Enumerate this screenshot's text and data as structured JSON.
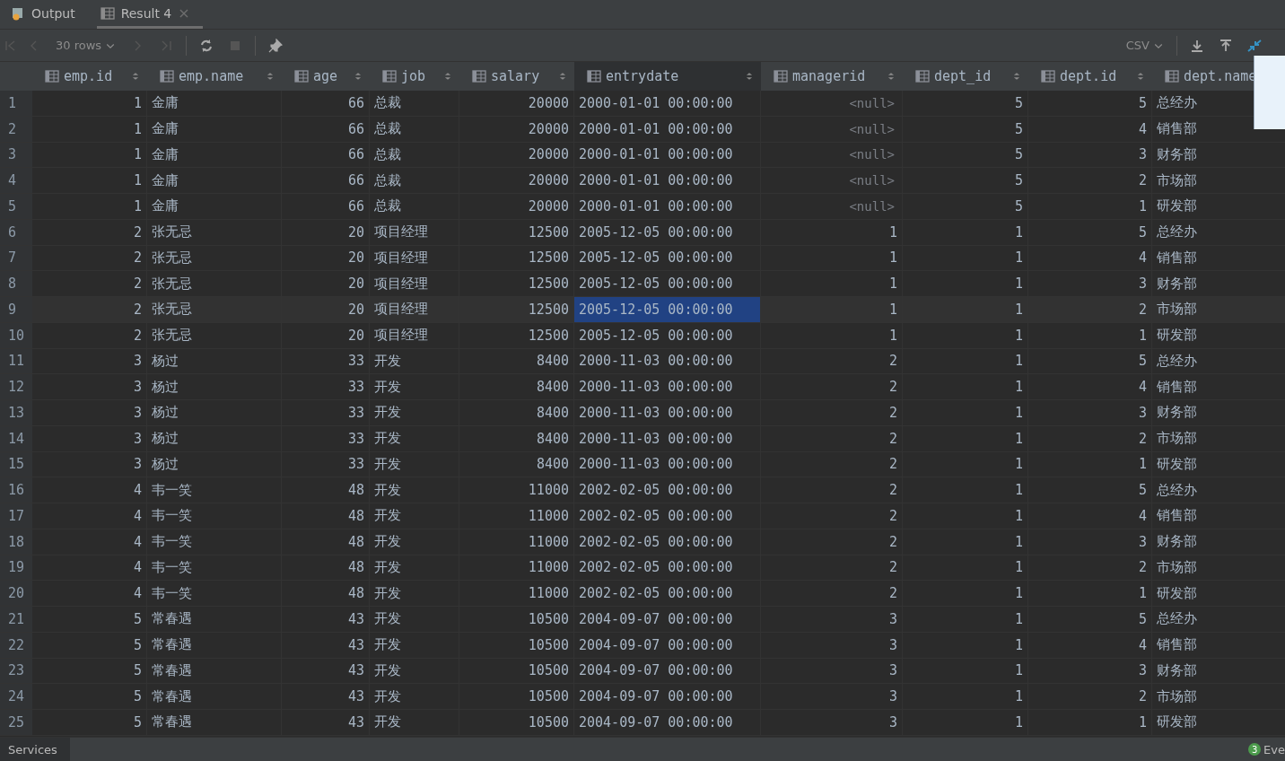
{
  "tabs": [
    {
      "label": "Output",
      "selected": false
    },
    {
      "label": "Result 4",
      "selected": true,
      "close": "×"
    }
  ],
  "toolbar": {
    "page_size": "30 rows",
    "format": "CSV"
  },
  "table": {
    "columns": [
      {
        "label": "emp.id",
        "kind": "number",
        "selected": false
      },
      {
        "label": "emp.name",
        "kind": "text",
        "selected": false
      },
      {
        "label": "age",
        "kind": "number",
        "selected": false
      },
      {
        "label": "job",
        "kind": "text",
        "selected": false
      },
      {
        "label": "salary",
        "kind": "number",
        "selected": false
      },
      {
        "label": "entrydate",
        "kind": "text",
        "selected": true
      },
      {
        "label": "managerid",
        "kind": "number",
        "selected": false
      },
      {
        "label": "dept_id",
        "kind": "number",
        "selected": false
      },
      {
        "label": "dept.id",
        "kind": "number",
        "selected": false
      },
      {
        "label": "dept.name",
        "kind": "text",
        "selected": false
      }
    ],
    "rows": [
      {
        "num": "1",
        "selected": false,
        "manager_null": true,
        "cells": [
          "1",
          "金庸",
          "66",
          "总裁",
          "20000",
          "2000-01-01 00:00:00",
          "<null>",
          "5",
          "5",
          "总经办"
        ]
      },
      {
        "num": "2",
        "selected": false,
        "manager_null": true,
        "cells": [
          "1",
          "金庸",
          "66",
          "总裁",
          "20000",
          "2000-01-01 00:00:00",
          "<null>",
          "5",
          "4",
          "销售部"
        ]
      },
      {
        "num": "3",
        "selected": false,
        "manager_null": true,
        "cells": [
          "1",
          "金庸",
          "66",
          "总裁",
          "20000",
          "2000-01-01 00:00:00",
          "<null>",
          "5",
          "3",
          "财务部"
        ]
      },
      {
        "num": "4",
        "selected": false,
        "manager_null": true,
        "cells": [
          "1",
          "金庸",
          "66",
          "总裁",
          "20000",
          "2000-01-01 00:00:00",
          "<null>",
          "5",
          "2",
          "市场部"
        ]
      },
      {
        "num": "5",
        "selected": false,
        "manager_null": true,
        "cells": [
          "1",
          "金庸",
          "66",
          "总裁",
          "20000",
          "2000-01-01 00:00:00",
          "<null>",
          "5",
          "1",
          "研发部"
        ]
      },
      {
        "num": "6",
        "selected": false,
        "manager_null": false,
        "cells": [
          "2",
          "张无忌",
          "20",
          "项目经理",
          "12500",
          "2005-12-05 00:00:00",
          "1",
          "1",
          "5",
          "总经办"
        ]
      },
      {
        "num": "7",
        "selected": false,
        "manager_null": false,
        "cells": [
          "2",
          "张无忌",
          "20",
          "项目经理",
          "12500",
          "2005-12-05 00:00:00",
          "1",
          "1",
          "4",
          "销售部"
        ]
      },
      {
        "num": "8",
        "selected": false,
        "manager_null": false,
        "cells": [
          "2",
          "张无忌",
          "20",
          "项目经理",
          "12500",
          "2005-12-05 00:00:00",
          "1",
          "1",
          "3",
          "财务部"
        ]
      },
      {
        "num": "9",
        "selected": true,
        "manager_null": false,
        "cells": [
          "2",
          "张无忌",
          "20",
          "项目经理",
          "12500",
          "2005-12-05 00:00:00",
          "1",
          "1",
          "2",
          "市场部"
        ]
      },
      {
        "num": "10",
        "selected": false,
        "manager_null": false,
        "cells": [
          "2",
          "张无忌",
          "20",
          "项目经理",
          "12500",
          "2005-12-05 00:00:00",
          "1",
          "1",
          "1",
          "研发部"
        ]
      },
      {
        "num": "11",
        "selected": false,
        "manager_null": false,
        "cells": [
          "3",
          "杨过",
          "33",
          "开发",
          "8400",
          "2000-11-03 00:00:00",
          "2",
          "1",
          "5",
          "总经办"
        ]
      },
      {
        "num": "12",
        "selected": false,
        "manager_null": false,
        "cells": [
          "3",
          "杨过",
          "33",
          "开发",
          "8400",
          "2000-11-03 00:00:00",
          "2",
          "1",
          "4",
          "销售部"
        ]
      },
      {
        "num": "13",
        "selected": false,
        "manager_null": false,
        "cells": [
          "3",
          "杨过",
          "33",
          "开发",
          "8400",
          "2000-11-03 00:00:00",
          "2",
          "1",
          "3",
          "财务部"
        ]
      },
      {
        "num": "14",
        "selected": false,
        "manager_null": false,
        "cells": [
          "3",
          "杨过",
          "33",
          "开发",
          "8400",
          "2000-11-03 00:00:00",
          "2",
          "1",
          "2",
          "市场部"
        ]
      },
      {
        "num": "15",
        "selected": false,
        "manager_null": false,
        "cells": [
          "3",
          "杨过",
          "33",
          "开发",
          "8400",
          "2000-11-03 00:00:00",
          "2",
          "1",
          "1",
          "研发部"
        ]
      },
      {
        "num": "16",
        "selected": false,
        "manager_null": false,
        "cells": [
          "4",
          "韦一笑",
          "48",
          "开发",
          "11000",
          "2002-02-05 00:00:00",
          "2",
          "1",
          "5",
          "总经办"
        ]
      },
      {
        "num": "17",
        "selected": false,
        "manager_null": false,
        "cells": [
          "4",
          "韦一笑",
          "48",
          "开发",
          "11000",
          "2002-02-05 00:00:00",
          "2",
          "1",
          "4",
          "销售部"
        ]
      },
      {
        "num": "18",
        "selected": false,
        "manager_null": false,
        "cells": [
          "4",
          "韦一笑",
          "48",
          "开发",
          "11000",
          "2002-02-05 00:00:00",
          "2",
          "1",
          "3",
          "财务部"
        ]
      },
      {
        "num": "19",
        "selected": false,
        "manager_null": false,
        "cells": [
          "4",
          "韦一笑",
          "48",
          "开发",
          "11000",
          "2002-02-05 00:00:00",
          "2",
          "1",
          "2",
          "市场部"
        ]
      },
      {
        "num": "20",
        "selected": false,
        "manager_null": false,
        "cells": [
          "4",
          "韦一笑",
          "48",
          "开发",
          "11000",
          "2002-02-05 00:00:00",
          "2",
          "1",
          "1",
          "研发部"
        ]
      },
      {
        "num": "21",
        "selected": false,
        "manager_null": false,
        "cells": [
          "5",
          "常春遇",
          "43",
          "开发",
          "10500",
          "2004-09-07 00:00:00",
          "3",
          "1",
          "5",
          "总经办"
        ]
      },
      {
        "num": "22",
        "selected": false,
        "manager_null": false,
        "cells": [
          "5",
          "常春遇",
          "43",
          "开发",
          "10500",
          "2004-09-07 00:00:00",
          "3",
          "1",
          "4",
          "销售部"
        ]
      },
      {
        "num": "23",
        "selected": false,
        "manager_null": false,
        "cells": [
          "5",
          "常春遇",
          "43",
          "开发",
          "10500",
          "2004-09-07 00:00:00",
          "3",
          "1",
          "3",
          "财务部"
        ]
      },
      {
        "num": "24",
        "selected": false,
        "manager_null": false,
        "cells": [
          "5",
          "常春遇",
          "43",
          "开发",
          "10500",
          "2004-09-07 00:00:00",
          "3",
          "1",
          "2",
          "市场部"
        ]
      },
      {
        "num": "25",
        "selected": false,
        "manager_null": false,
        "cells": [
          "5",
          "常春遇",
          "43",
          "开发",
          "10500",
          "2004-09-07 00:00:00",
          "3",
          "1",
          "1",
          "研发部"
        ]
      }
    ]
  },
  "status_bar": {
    "left_tab": "Services",
    "badge": "3",
    "right_tab": "Eve"
  }
}
